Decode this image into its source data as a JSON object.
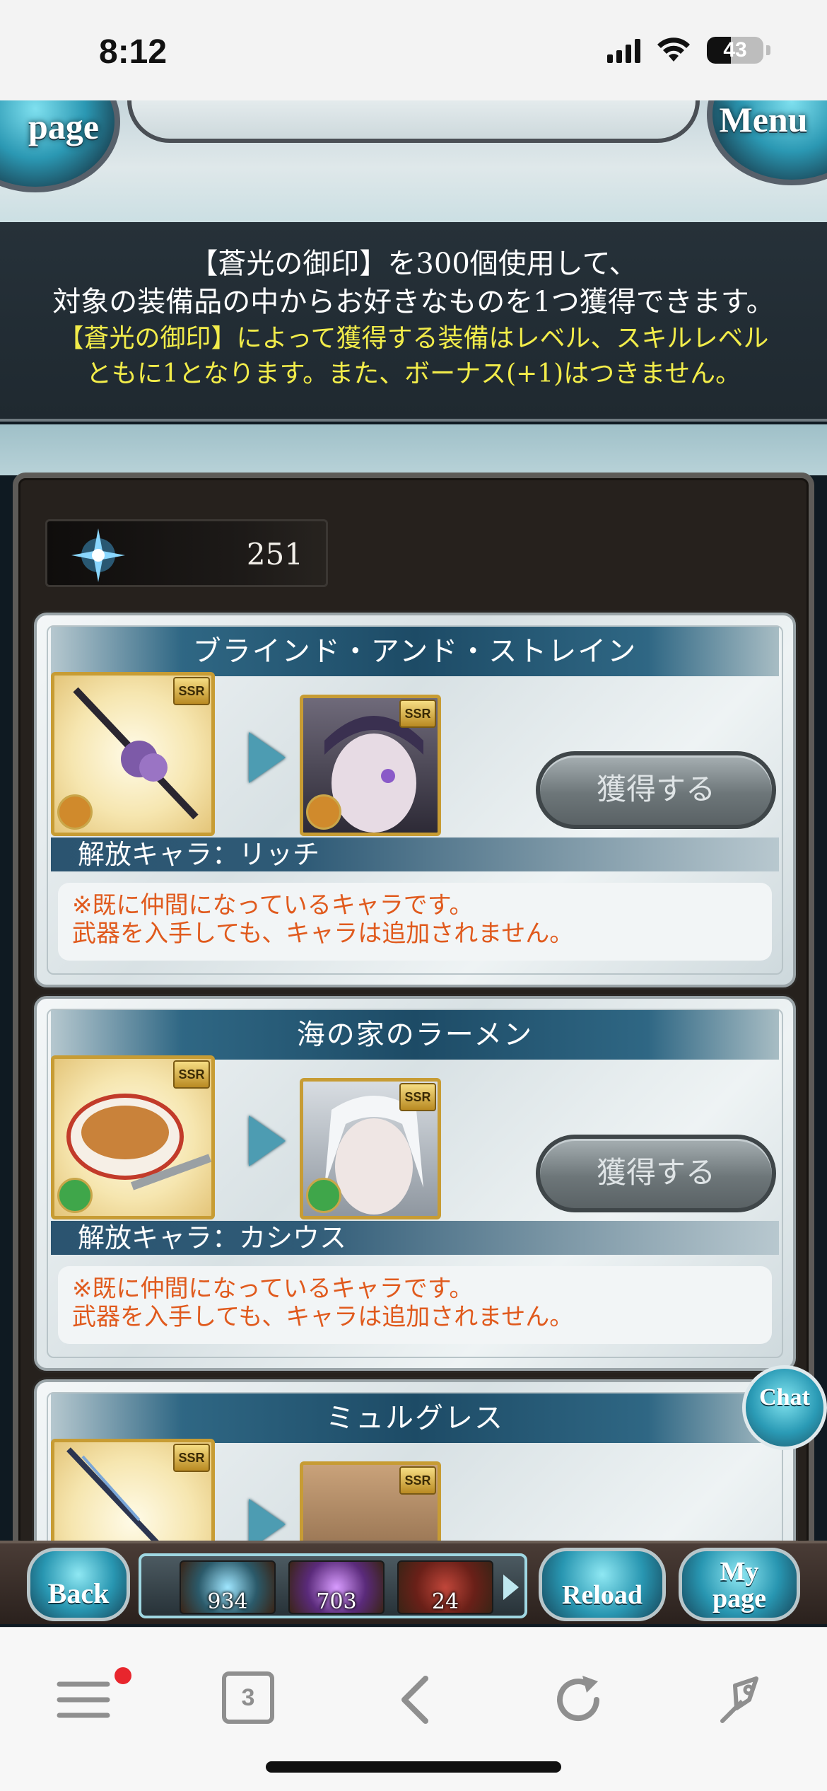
{
  "status_bar": {
    "time": "8:12",
    "battery": "43",
    "battery_level": 0.43
  },
  "game_header": {
    "mypage_label": "page",
    "menu_label": "Menu"
  },
  "info": {
    "line1": "【蒼光の御印】を300個使用して、",
    "line2": "対象の装備品の中からお好きなものを1つ獲得できます。",
    "line3": "【蒼光の御印】によって獲得する装備はレベル、スキルレベル",
    "line4": "ともに1となります。また、ボーナス(+1)はつきません。"
  },
  "seal": {
    "count": "251",
    "icon": "blue-star-seal-icon"
  },
  "items": [
    {
      "name": "ブラインド・アンド・ストレイン",
      "rarity": "SSR",
      "element_color": "#d08a2c",
      "obtain_label": "獲得する",
      "release_label": "解放キャラ：リッチ",
      "note1": "※既に仲間になっているキャラです。",
      "note2": "武器を入手しても、キャラは追加されません。"
    },
    {
      "name": "海の家のラーメン",
      "rarity": "SSR",
      "element_color": "#3fa64a",
      "obtain_label": "獲得する",
      "release_label": "解放キャラ：カシウス",
      "note1": "※既に仲間になっているキャラです。",
      "note2": "武器を入手しても、キャラは追加されません。"
    },
    {
      "name": "ミュルグレス",
      "rarity": "SSR"
    }
  ],
  "chat": {
    "label": "Chat"
  },
  "game_nav": {
    "back_label": "Back",
    "reload_label": "Reload",
    "mypage_line1": "My",
    "mypage_line2": "page",
    "resources": [
      {
        "count": "934",
        "icon": "crystal-icon"
      },
      {
        "count": "703",
        "icon": "purple-crystal-icon"
      },
      {
        "count": "24",
        "icon": "book-icon"
      }
    ]
  },
  "safari": {
    "tab_count": "3"
  }
}
